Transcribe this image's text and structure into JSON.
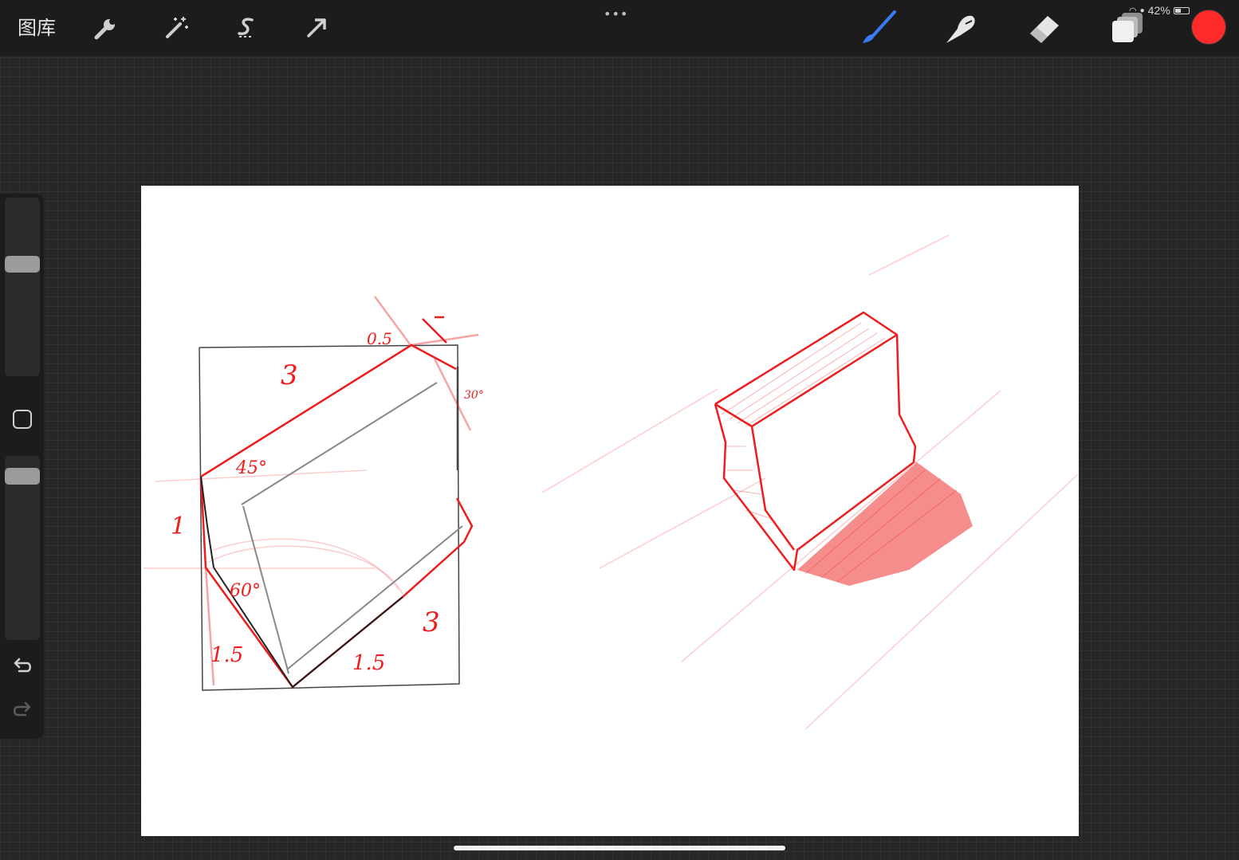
{
  "topbar": {
    "gallery_label": "图库",
    "left_tools": [
      "wrench-icon",
      "magic-wand-icon",
      "selection-icon",
      "transform-arrow-icon"
    ],
    "more_label": "•••",
    "right_tools": [
      "brush-icon",
      "smudge-icon",
      "eraser-icon",
      "layers-icon"
    ],
    "current_color": "#ff2a2a",
    "status": {
      "battery_percent": "42%",
      "battery_level": 0.42
    }
  },
  "sidebar": {
    "brush_size_level": 0.64,
    "opacity_level": 0.93,
    "controls": [
      "modify-button",
      "undo-icon",
      "redo-icon"
    ]
  },
  "canvas": {
    "background": "#ffffff",
    "annotations": {
      "top_length": "3",
      "top_small": "0.5",
      "angle_top": "45°",
      "angle_right": "30°",
      "left_length": "1",
      "angle_bottom": "60°",
      "bottom_left": "1.5",
      "bottom_right": "1.5",
      "right_length": "3"
    }
  },
  "colors": {
    "ink_red": "#ee1c1c",
    "graphite": "#333333",
    "accent_blue": "#3a7bf5"
  }
}
